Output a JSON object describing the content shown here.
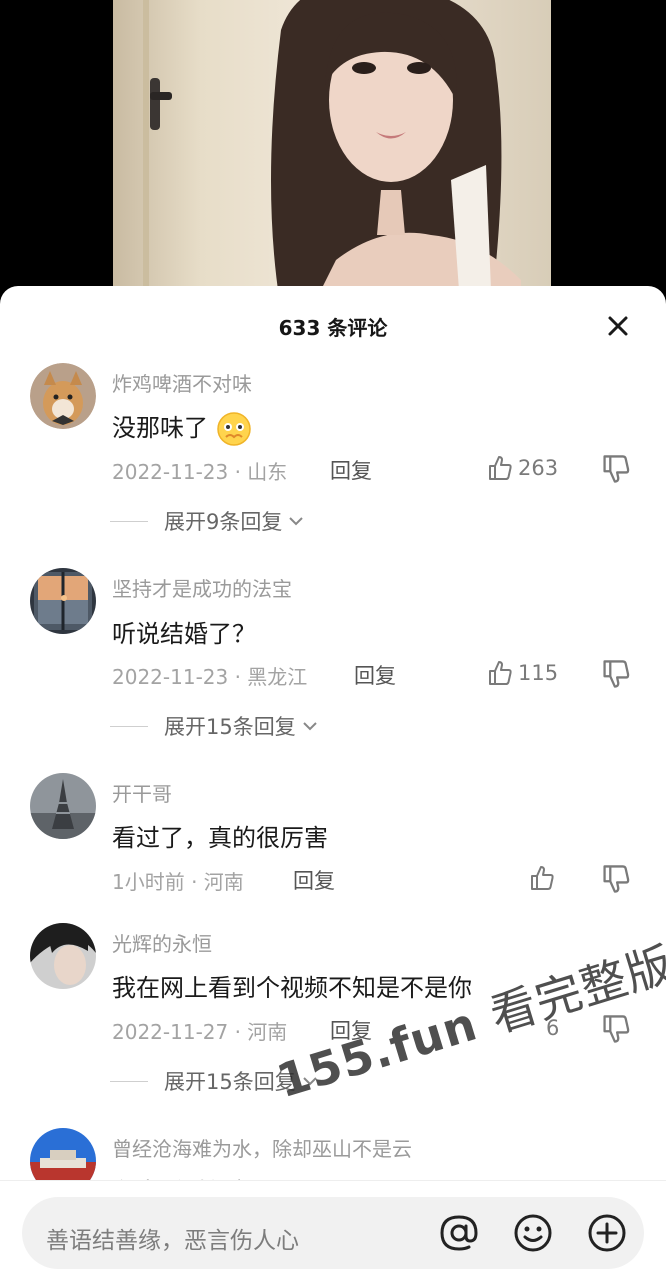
{
  "sheet": {
    "title": "633 条评论"
  },
  "comments": [
    {
      "user": "炸鸡啤酒不对味",
      "text": "没那味了",
      "date": "2022-11-23 · 山东",
      "reply": "回复",
      "likes": "263",
      "expand": "展开9条回复"
    },
    {
      "user": "坚持才是成功的法宝",
      "text": "听说结婚了？",
      "date": "2022-11-23 · 黑龙江",
      "reply": "回复",
      "likes": "115",
      "expand": "展开15条回复"
    },
    {
      "user": "开干哥",
      "text": "看过了，真的很厉害",
      "date": "1小时前 · 河南",
      "reply": "回复",
      "likes": ""
    },
    {
      "user": "光辉的永恒",
      "text": "我在网上看到个视频不知是不是你",
      "date": "2022-11-27 · 河南",
      "reply": "回复",
      "likes": "6",
      "expand": "展开15条回复"
    },
    {
      "user": "曾经沧海难为水，除却巫山不是云",
      "text": "有点看过视频"
    }
  ],
  "input": {
    "placeholder": "善语结善缘，恶言伤人心"
  },
  "watermark": {
    "site": "155.fun",
    "text": "看完整版"
  },
  "icons": [
    "close-icon",
    "thumbs-up-icon",
    "thumbs-down-icon",
    "chevron-down-icon",
    "at-icon",
    "emoji-icon",
    "plus-icon"
  ]
}
